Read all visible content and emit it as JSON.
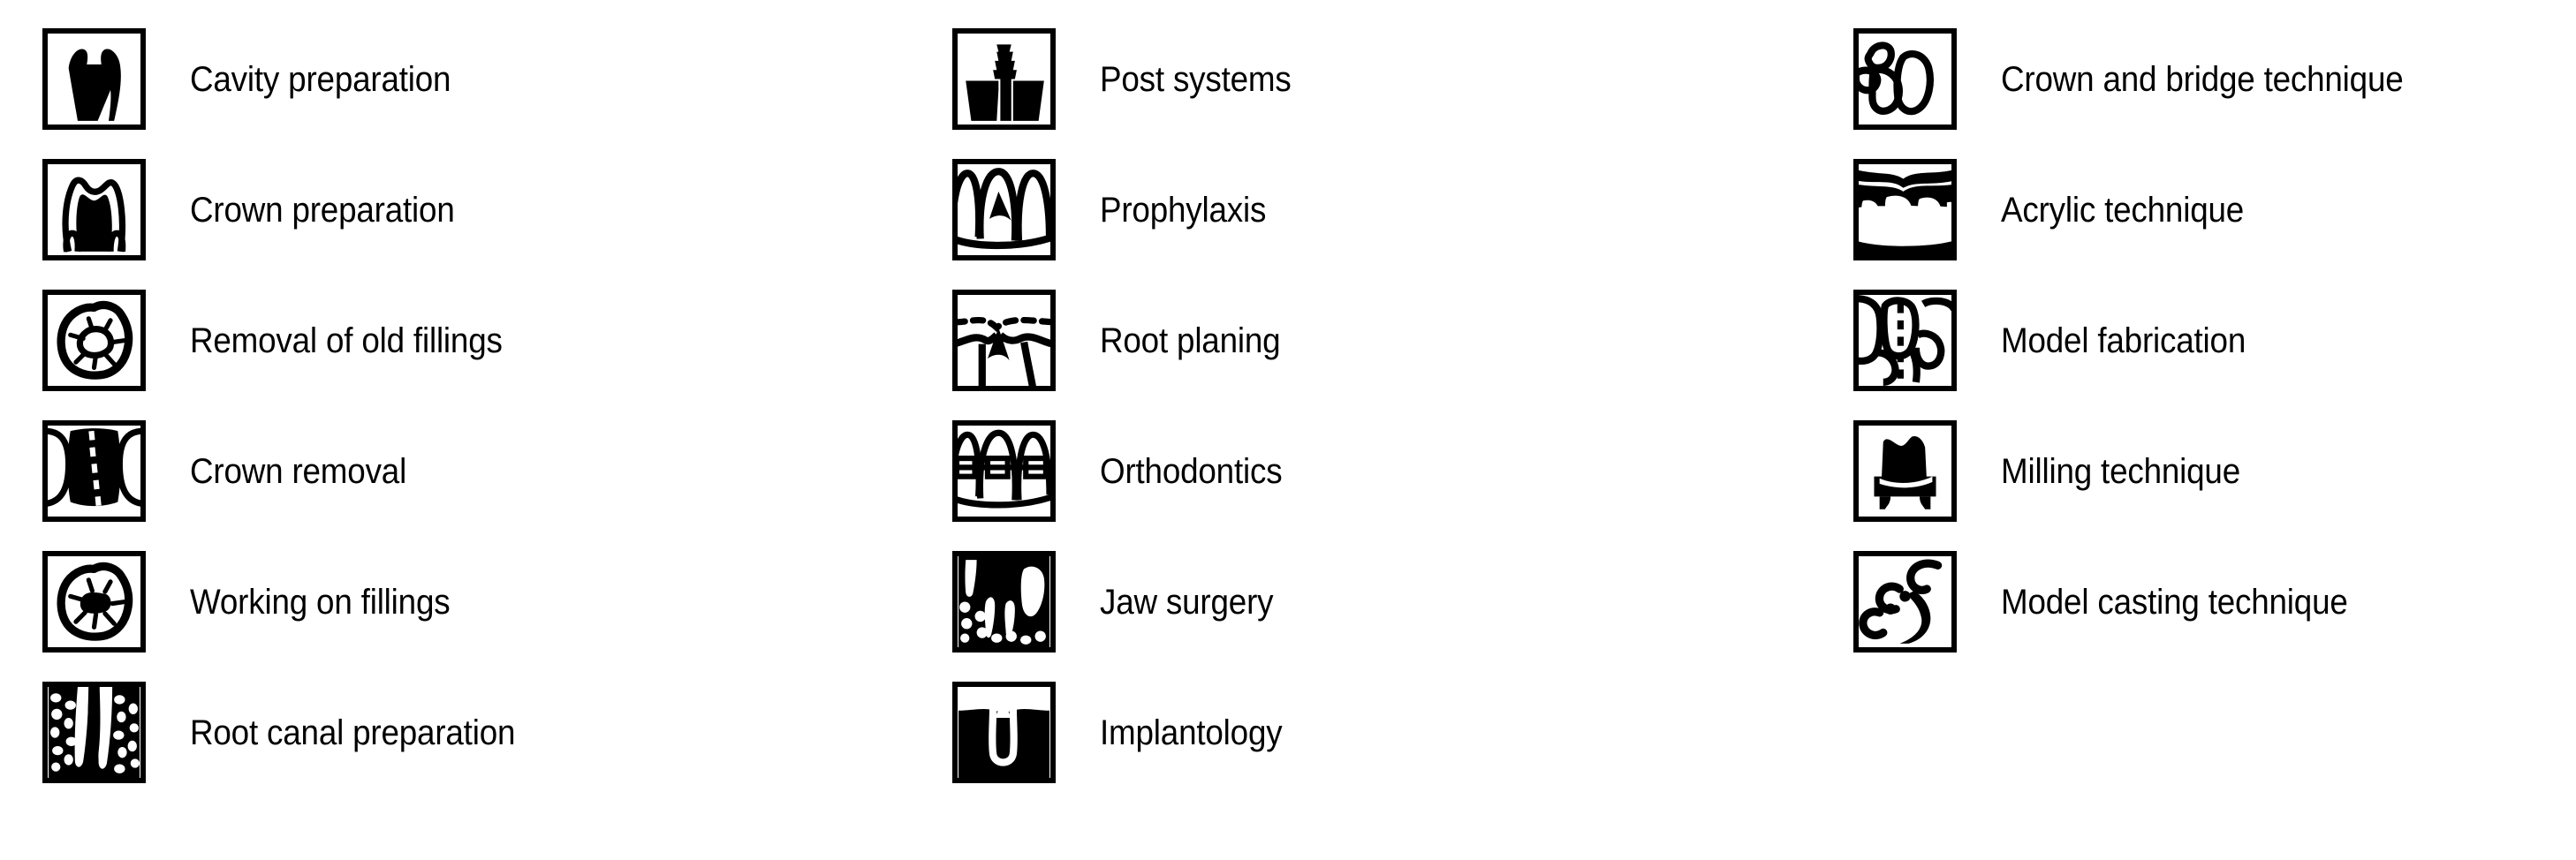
{
  "page": {
    "background_color": "#ffffff",
    "text_color": "#000000",
    "title": "Dental treatment icon legend"
  },
  "columns": [
    {
      "name": "column-1",
      "items": [
        {
          "label": "Cavity preparation",
          "icon": "tooth-cavity-prep-icon"
        },
        {
          "label": "Crown preparation",
          "icon": "tooth-crown-prep-icon"
        },
        {
          "label": "Removal of old fillings",
          "icon": "occlusal-old-filling-icon"
        },
        {
          "label": "Crown removal",
          "icon": "tooth-crown-removal-icon"
        },
        {
          "label": "Working on fillings",
          "icon": "occlusal-filling-work-icon"
        },
        {
          "label": "Root canal preparation",
          "icon": "tooth-root-canal-icon"
        }
      ]
    },
    {
      "name": "column-2",
      "items": [
        {
          "label": "Post systems",
          "icon": "tooth-post-system-icon"
        },
        {
          "label": "Prophylaxis",
          "icon": "teeth-prophylaxis-icon"
        },
        {
          "label": "Root planing",
          "icon": "gum-root-planing-icon"
        },
        {
          "label": "Orthodontics",
          "icon": "teeth-braces-icon"
        },
        {
          "label": "Jaw surgery",
          "icon": "jaw-surgery-icon"
        },
        {
          "label": "Implantology",
          "icon": "dental-implant-icon"
        }
      ]
    },
    {
      "name": "column-3",
      "items": [
        {
          "label": "Crown and bridge technique",
          "icon": "crown-bridge-icon"
        },
        {
          "label": "Acrylic technique",
          "icon": "acrylic-denture-icon"
        },
        {
          "label": "Model fabrication",
          "icon": "model-fabrication-icon"
        },
        {
          "label": "Milling technique",
          "icon": "milling-die-icon"
        },
        {
          "label": "Model casting technique",
          "icon": "model-casting-clasp-icon"
        }
      ]
    }
  ]
}
